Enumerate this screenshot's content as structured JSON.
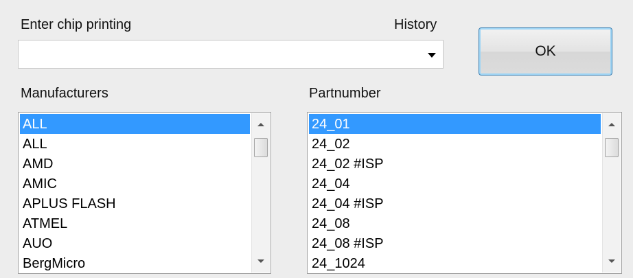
{
  "chip": {
    "label": "Enter chip printing",
    "history_label": "History",
    "value": "",
    "placeholder": ""
  },
  "ok_button": {
    "label": "OK"
  },
  "manufacturers": {
    "label": "Manufacturers",
    "items": [
      "ALL",
      "ALL",
      "AMD",
      "AMIC",
      "APLUS FLASH",
      "ATMEL",
      "AUO",
      "BergMicro"
    ],
    "selected_index": 0
  },
  "partnumber": {
    "label": "Partnumber",
    "items": [
      "24_01",
      "24_02",
      "24_02 #ISP",
      "24_04",
      "24_04 #ISP",
      "24_08",
      "24_08 #ISP",
      "24_1024"
    ],
    "selected_index": 0
  },
  "colors": {
    "selection": "#3399ff",
    "ok_border": "#3c7fb1"
  },
  "icons": {
    "combo_arrow": "chevron-down-icon",
    "scroll_up": "scroll-up-icon",
    "scroll_down": "scroll-down-icon"
  }
}
